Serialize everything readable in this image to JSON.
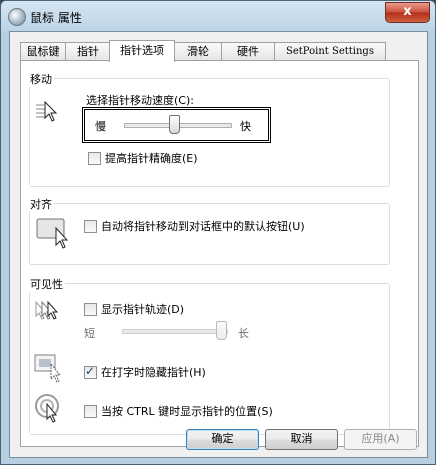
{
  "window": {
    "title": "鼠标 属性",
    "close_glyph": "x"
  },
  "tabs": [
    {
      "label": "鼠标键",
      "active": false
    },
    {
      "label": "指针",
      "active": false
    },
    {
      "label": "指针选项",
      "active": true
    },
    {
      "label": "滑轮",
      "active": false
    },
    {
      "label": "硬件",
      "active": false
    },
    {
      "label": "SetPoint Settings",
      "active": false
    }
  ],
  "motion": {
    "heading": "移动",
    "speed_label": "选择指针移动速度(C):",
    "slow_label": "慢",
    "fast_label": "快",
    "speed_position": 0.5,
    "precision_label": "提高指针精确度(E)",
    "precision_checked": false
  },
  "snap": {
    "heading": "对齐",
    "snap_label": "自动将指针移动到对话框中的默认按钮(U)",
    "snap_checked": false
  },
  "visibility": {
    "heading": "可见性",
    "trails_label": "显示指针轨迹(D)",
    "trails_checked": false,
    "short_label": "短",
    "long_label": "长",
    "trail_position": 1.0,
    "hide_label": "在打字时隐藏指针(H)",
    "hide_checked": true,
    "ctrl_label": "当按 CTRL 键时显示指针的位置(S)",
    "ctrl_checked": false
  },
  "buttons": {
    "ok": "确定",
    "cancel": "取消",
    "apply": "应用(A)"
  },
  "colors": {
    "title_bar": "#bcd3e5",
    "close_button": "#c94e3a",
    "default_button_border": "#3c7fb1"
  }
}
